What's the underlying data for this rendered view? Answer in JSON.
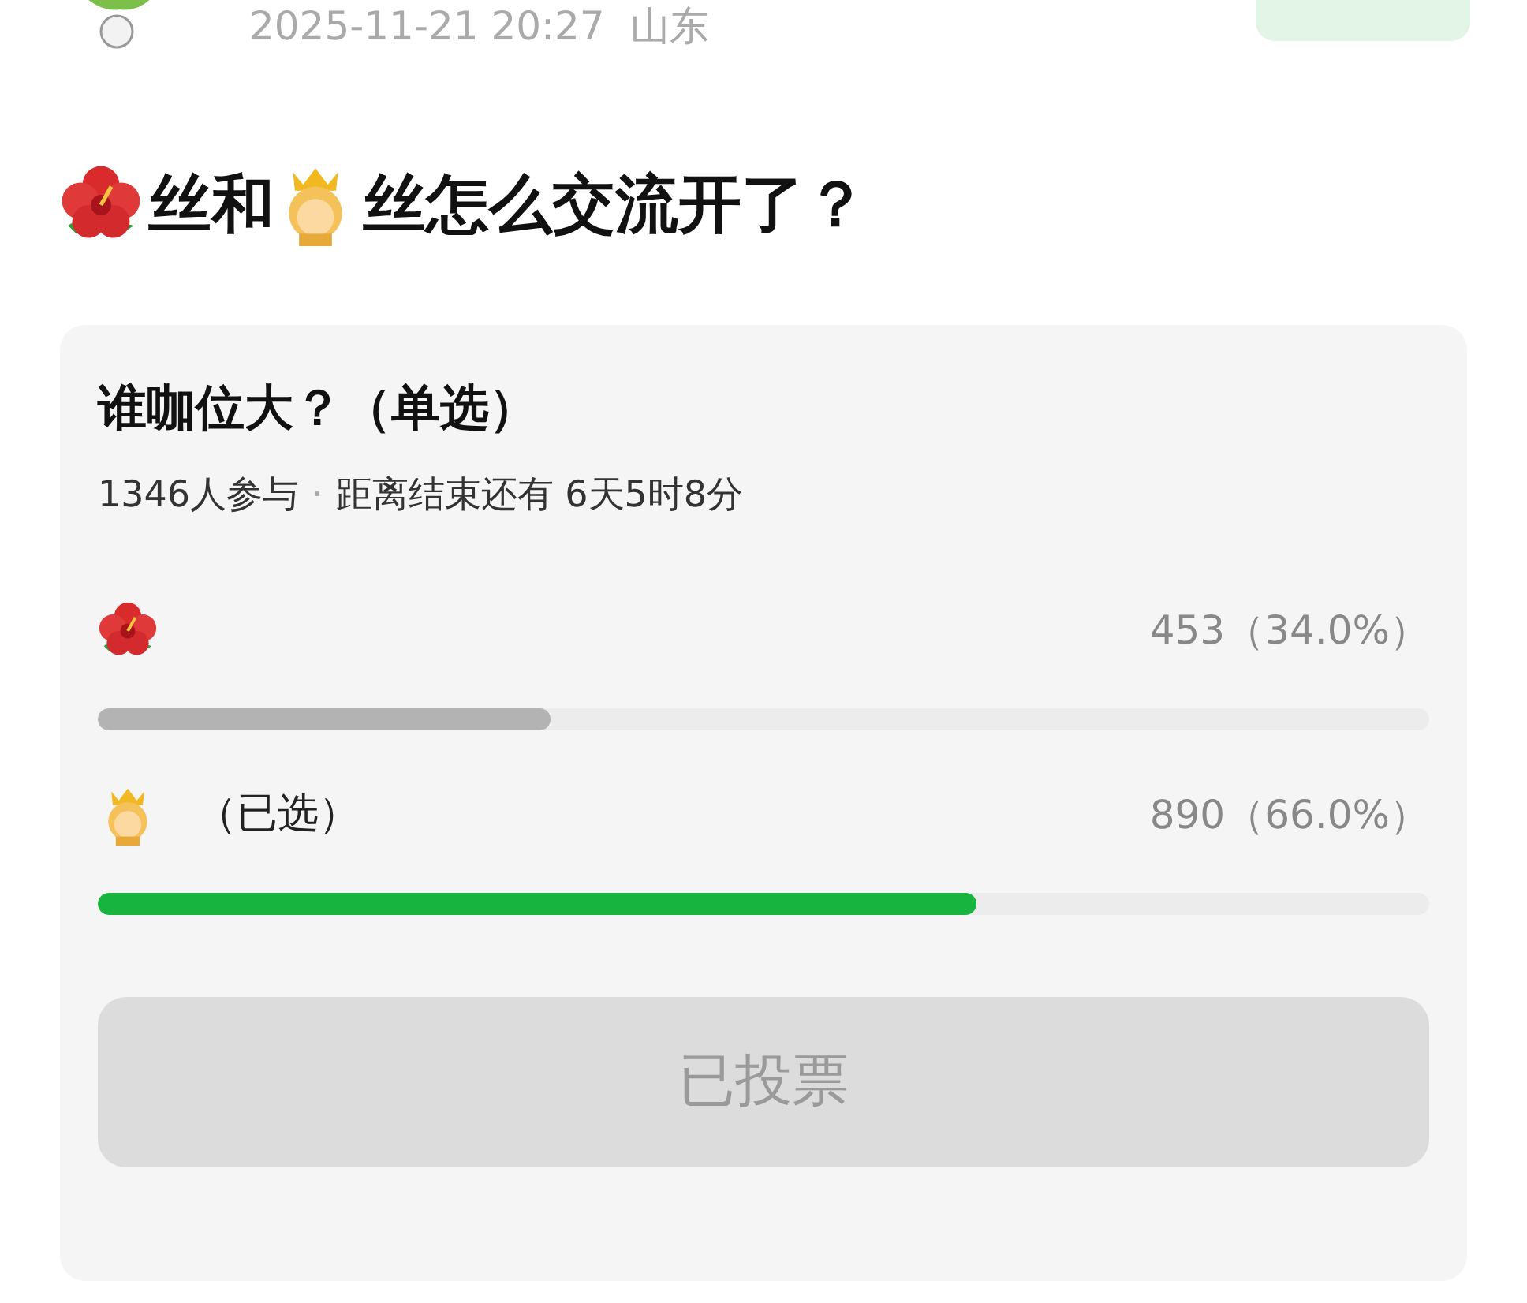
{
  "post": {
    "time": "2025-11-21 20:27",
    "location": "山东"
  },
  "title_parts": [
    {
      "kind": "hibiscus"
    },
    {
      "kind": "text",
      "text": "丝和"
    },
    {
      "kind": "princess"
    },
    {
      "kind": "text",
      "text": "丝怎么交流开了？"
    }
  ],
  "poll": {
    "question": "谁咖位大？（单选）",
    "participants": "1346人参与",
    "separator": "·",
    "remaining": "距离结束还有 6天5时8分",
    "options": [
      {
        "kind": "hibiscus",
        "selected": false,
        "result": "453（34.0%）",
        "level": 0.34
      },
      {
        "kind": "princess",
        "selected": true,
        "selected_label": "（已选）",
        "result": "890（66.0%）",
        "level": 0.66
      }
    ],
    "button": {
      "label": "已投票",
      "disabled": true
    }
  }
}
